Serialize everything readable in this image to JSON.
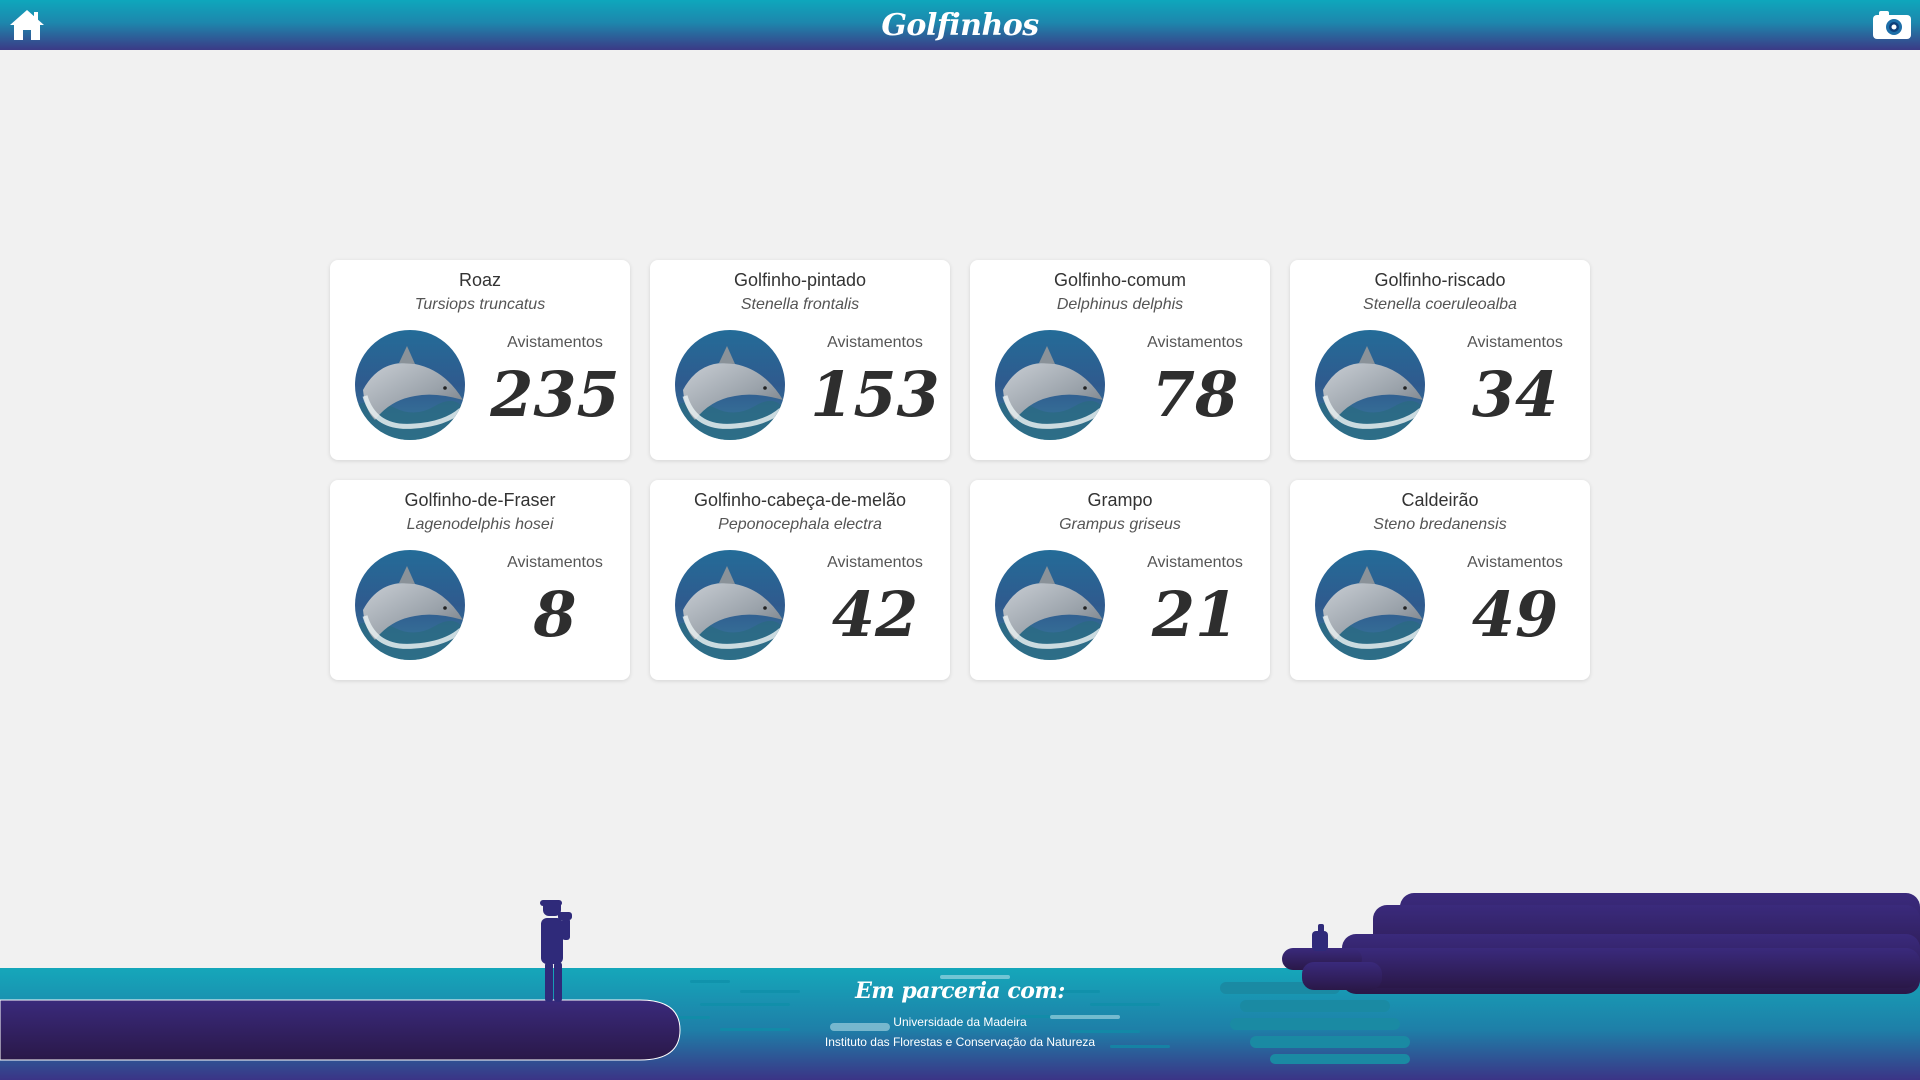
{
  "header": {
    "title": "Golfinhos"
  },
  "cards": [
    {
      "name": "Roaz",
      "scientific": "Tursiops truncatus",
      "label": "Avistamentos",
      "count": "235"
    },
    {
      "name": "Golfinho-pintado",
      "scientific": "Stenella frontalis",
      "label": "Avistamentos",
      "count": "153"
    },
    {
      "name": "Golfinho-comum",
      "scientific": "Delphinus delphis",
      "label": "Avistamentos",
      "count": "78"
    },
    {
      "name": "Golfinho-riscado",
      "scientific": "Stenella coeruleoalba",
      "label": "Avistamentos",
      "count": "34"
    },
    {
      "name": "Golfinho-de-Fraser",
      "scientific": "Lagenodelphis hosei",
      "label": "Avistamentos",
      "count": "8"
    },
    {
      "name": "Golfinho-cabeça-de-melão",
      "scientific": "Peponocephala electra",
      "label": "Avistamentos",
      "count": "42"
    },
    {
      "name": "Grampo",
      "scientific": "Grampus griseus",
      "label": "Avistamentos",
      "count": "21"
    },
    {
      "name": "Caldeirão",
      "scientific": "Steno bredanensis",
      "label": "Avistamentos",
      "count": "49"
    }
  ],
  "footer": {
    "partner_title": "Em parceria com:",
    "partners": [
      "Universidade da Madeira",
      "Instituto das Florestas e Conservação da Natureza"
    ]
  },
  "icons": {
    "home": "home-icon",
    "camera": "camera-icon",
    "dolphin": "dolphin-photo"
  },
  "colors": {
    "header_top": "#0ea7bc",
    "header_bottom": "#3b3a86",
    "sea": "#14a3b7",
    "silhouette": "#2f1f5a"
  }
}
